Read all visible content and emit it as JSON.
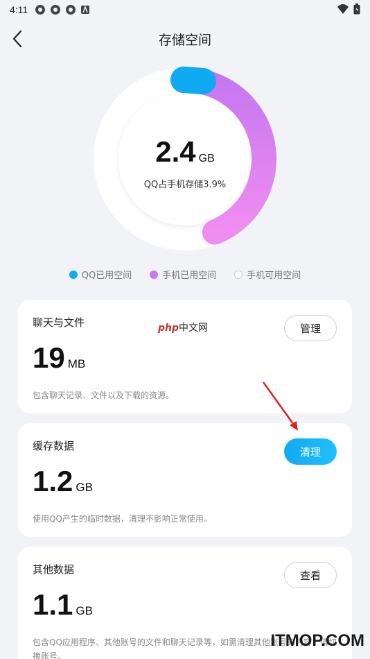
{
  "status_bar": {
    "time": "4:11"
  },
  "header": {
    "title": "存储空间"
  },
  "summary": {
    "value": "2.4",
    "unit": "GB",
    "caption": "QQ占手机存储3.9%",
    "qq_used_fraction": 0.039,
    "colors": {
      "qq": "#10aaf3",
      "phone_used": "#d97cf5",
      "free": "#ffffff"
    }
  },
  "legend": [
    {
      "label": "QQ已用空间",
      "color": "#10aaf3"
    },
    {
      "label": "手机已用空间",
      "color": "#c978f2"
    },
    {
      "label": "手机可用空间",
      "color": "#ffffff"
    }
  ],
  "watermark": {
    "brand": "php",
    "suffix": "中文网"
  },
  "cards": [
    {
      "title": "聊天与文件",
      "value": "19",
      "unit": "MB",
      "desc": "包含聊天记录、文件以及下载的资源。",
      "button": "管理",
      "button_style": "outline"
    },
    {
      "title": "缓存数据",
      "value": "1.2",
      "unit": "GB",
      "desc": "使用QQ产生的临时数据，清理不影响正常使用。",
      "button": "清理",
      "button_style": "primary"
    },
    {
      "title": "其他数据",
      "value": "1.1",
      "unit": "GB",
      "desc": "包含QQ应用程序、其他账号的文件和聊天记录等，如需清理其他账号的内容，请切换账号。",
      "button": "查看",
      "button_style": "outline"
    }
  ],
  "site_watermark": "ITMOP.COM"
}
